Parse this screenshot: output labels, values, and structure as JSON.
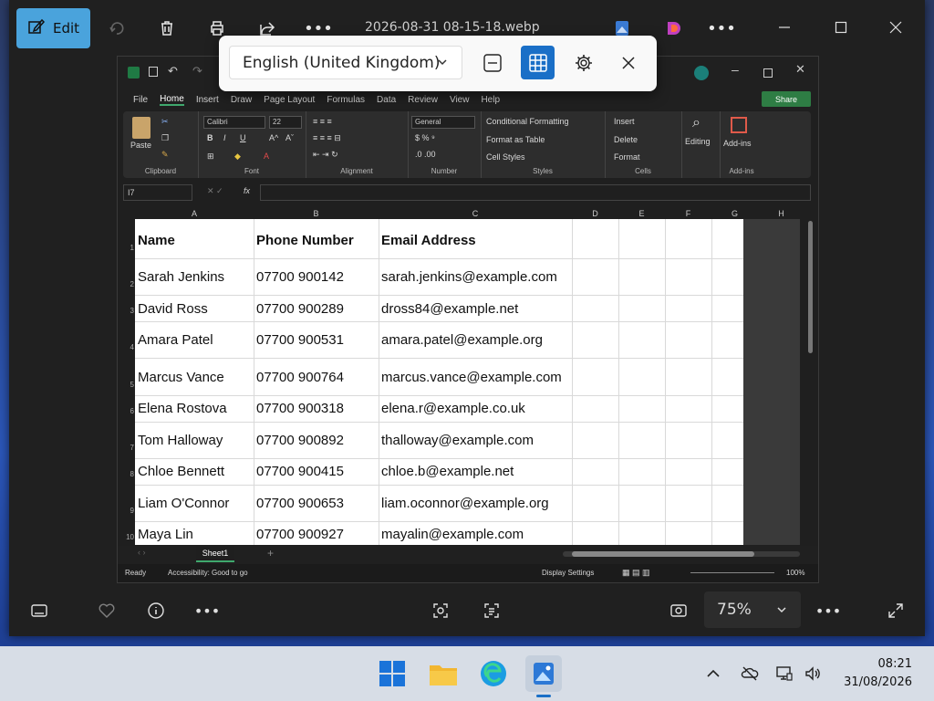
{
  "viewer": {
    "edit_label": "Edit",
    "file_title": "2026-08-31 08-15-18.webp",
    "zoom_value": "75%"
  },
  "language_popup": {
    "selected_language": "English (United Kingdom)"
  },
  "excel": {
    "menu_tabs": [
      "File",
      "Home",
      "Insert",
      "Draw",
      "Page Layout",
      "Formulas",
      "Data",
      "Review",
      "View",
      "Help"
    ],
    "active_tab": "Home",
    "share_label": "Share",
    "ribbon": {
      "paste": "Paste",
      "clipboard": "Clipboard",
      "font_name": "Calibri",
      "font_size": "22",
      "font_group": "Font",
      "alignment_group": "Alignment",
      "number_format": "General",
      "number_group": "Number",
      "conditional_formatting": "Conditional Formatting",
      "format_as_table": "Format as Table",
      "cell_styles": "Cell Styles",
      "styles_group": "Styles",
      "insert": "Insert",
      "delete": "Delete",
      "format": "Format",
      "cells_group": "Cells",
      "editing": "Editing",
      "add_ins": "Add-ins",
      "add_ins_group": "Add-ins"
    },
    "name_box": "I7",
    "column_letters": [
      "A",
      "B",
      "C",
      "D",
      "E",
      "F",
      "G",
      "H"
    ],
    "row_numbers": [
      "1",
      "2",
      "3",
      "4",
      "5",
      "6",
      "7",
      "8",
      "9",
      "10"
    ],
    "headers": [
      "Name",
      "Phone Number",
      "Email Address"
    ],
    "rows": [
      [
        "Sarah Jenkins",
        "07700 900142",
        "sarah.jenkins@example.com"
      ],
      [
        "David Ross",
        "07700 900289",
        "dross84@example.net"
      ],
      [
        "Amara Patel",
        "07700 900531",
        "amara.patel@example.org"
      ],
      [
        "Marcus Vance",
        "07700 900764",
        "marcus.vance@example.com"
      ],
      [
        "Elena Rostova",
        "07700 900318",
        "elena.r@example.co.uk"
      ],
      [
        "Tom Halloway",
        "07700 900892",
        "thalloway@example.com"
      ],
      [
        "Chloe Bennett",
        "07700 900415",
        "chloe.b@example.net"
      ],
      [
        "Liam O'Connor",
        "07700 900653",
        "liam.oconnor@example.org"
      ],
      [
        "Maya Lin",
        "07700 900927",
        "mayalin@example.com"
      ]
    ],
    "sheet_tab": "Sheet1",
    "status_ready": "Ready",
    "status_accessibility": "Accessibility: Good to go",
    "display_settings": "Display Settings",
    "zoom": "100%"
  },
  "taskbar": {
    "time": "08:21",
    "date": "31/08/2026"
  },
  "colors": {
    "accent": "#4aa3dc",
    "selected_button": "#1a6fc7",
    "excel_green": "#2e7d44"
  }
}
